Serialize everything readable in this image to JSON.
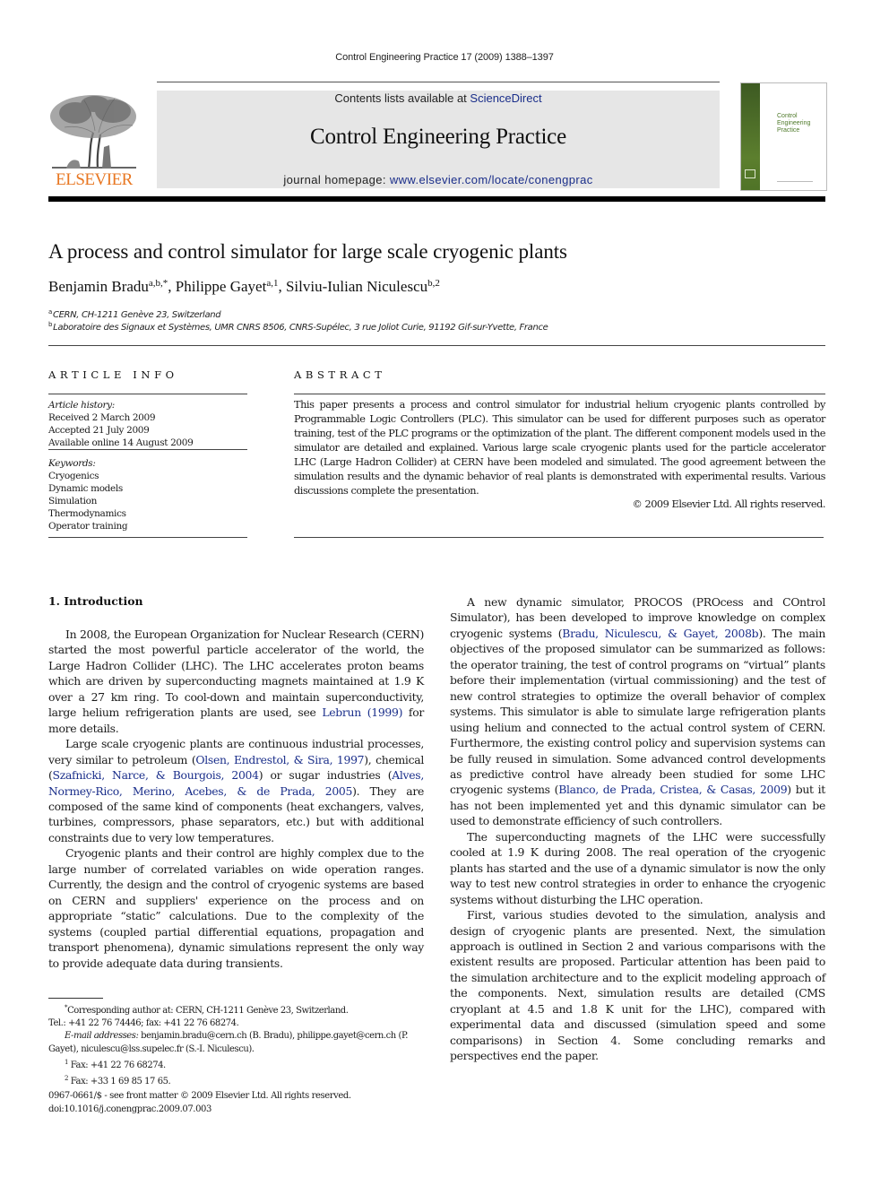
{
  "running_head": "Control Engineering Practice 17 (2009) 1388–1397",
  "masthead": {
    "publisher_logo_text": "ELSEVIER",
    "contents_prefix": "Contents lists available at ",
    "contents_link": "ScienceDirect",
    "journal_title": "Control Engineering Practice",
    "homepage_prefix": "journal homepage: ",
    "homepage_link": "www.elsevier.com/locate/conengprac",
    "cover_title": "Control\nEngineering\nPractice",
    "colors": {
      "elsevier_orange": "#e87722",
      "link_blue": "#1a2e8a",
      "masthead_gray": "#e6e6e6",
      "cover_green": "#4f7327"
    }
  },
  "article": {
    "title": "A process and control simulator for large scale cryogenic plants",
    "authors": [
      {
        "name": "Benjamin Bradu",
        "marks": "a,b,*",
        "sep": ", "
      },
      {
        "name": "Philippe Gayet",
        "marks": "a,1",
        "sep": ", "
      },
      {
        "name": "Silviu-Iulian Niculescu",
        "marks": "b,2",
        "sep": ""
      }
    ],
    "affiliations": [
      {
        "mark": "a",
        "text": "CERN, CH-1211 Genève 23, Switzerland"
      },
      {
        "mark": "b",
        "text": "Laboratoire des Signaux et Systèmes, UMR CNRS 8506, CNRS-Supélec, 3 rue Joliot Curie, 91192 Gif-sur-Yvette, France"
      }
    ]
  },
  "article_info": {
    "heading": "ARTICLE INFO",
    "history_label": "Article history:",
    "history": [
      "Received 2 March 2009",
      "Accepted 21 July 2009",
      "Available online 14 August 2009"
    ],
    "keywords_label": "Keywords:",
    "keywords": [
      "Cryogenics",
      "Dynamic models",
      "Simulation",
      "Thermodynamics",
      "Operator training"
    ]
  },
  "abstract": {
    "heading": "ABSTRACT",
    "text": "This paper presents a process and control simulator for industrial helium cryogenic plants controlled by Programmable Logic Controllers (PLC). This simulator can be used for different purposes such as operator training, test of the PLC programs or the optimization of the plant. The different component models used in the simulator are detailed and explained. Various large scale cryogenic plants used for the particle accelerator LHC (Large Hadron Collider) at CERN have been modeled and simulated. The good agreement between the simulation results and the dynamic behavior of real plants is demonstrated with experimental results. Various discussions complete the presentation.",
    "copyright": "© 2009 Elsevier Ltd. All rights reserved."
  },
  "body": {
    "section_heading": "1.  Introduction",
    "left_paragraphs": [
      [
        {
          "t": "In 2008, the European Organization for Nuclear Research (CERN) started the most powerful particle accelerator of the world, the Large Hadron Collider (LHC). The LHC accelerates proton beams which are driven by superconducting magnets maintained at 1.9 K over a 27 km ring. To cool-down and maintain superconductivity, large helium refrigeration plants are used, see "
        },
        {
          "t": "Lebrun (1999)",
          "link": true
        },
        {
          "t": " for more details."
        }
      ],
      [
        {
          "t": "Large scale cryogenic plants are continuous industrial processes, very similar to petroleum ("
        },
        {
          "t": "Olsen, Endrestol, & Sira, 1997",
          "link": true
        },
        {
          "t": "), chemical ("
        },
        {
          "t": "Szafnicki, Narce, & Bourgois, 2004",
          "link": true
        },
        {
          "t": ") or sugar industries ("
        },
        {
          "t": "Alves, Normey-Rico, Merino, Acebes, & de Prada, 2005",
          "link": true
        },
        {
          "t": "). They are composed of the same kind of components (heat exchangers, valves, turbines, compressors, phase separators, etc.) but with additional constraints due to very low temperatures."
        }
      ],
      [
        {
          "t": "Cryogenic plants and their control are highly complex due to the large number of correlated variables on wide operation ranges. Currently, the design and the control of cryogenic systems are based on CERN and suppliers' experience on the process and on appropriate “static” calculations. Due to the complexity of the systems (coupled partial differential equations, propagation and transport phenomena), dynamic simulations represent the only way to provide adequate data during transients."
        }
      ]
    ],
    "right_paragraphs": [
      [
        {
          "t": "A new dynamic simulator, PROCOS (PROcess and COntrol Simulator), has been developed to improve knowledge on complex cryogenic systems ("
        },
        {
          "t": "Bradu, Niculescu, & Gayet, 2008b",
          "link": true
        },
        {
          "t": "). The main objectives of the proposed simulator can be summarized as follows: the operator training, the test of control programs on “virtual” plants before their implementation (virtual commissioning) and the test of new control strategies to optimize the overall behavior of complex systems. This simulator is able to simulate large refrigeration plants using helium and connected to the actual control system of CERN. Furthermore, the existing control policy and supervision systems can be fully reused in simulation. Some advanced control developments as predictive control have already been studied for some LHC cryogenic systems ("
        },
        {
          "t": "Blanco, de Prada, Cristea, & Casas, 2009",
          "link": true
        },
        {
          "t": ") but it has not been implemented yet and this dynamic simulator can be used to demonstrate efficiency of such controllers."
        }
      ],
      [
        {
          "t": "The superconducting magnets of the LHC were successfully cooled at 1.9 K during 2008. The real operation of the cryogenic plants has started and the use of a dynamic simulator is now the only way to test new control strategies in order to enhance the cryogenic systems without disturbing the LHC operation."
        }
      ],
      [
        {
          "t": "First, various studies devoted to the simulation, analysis and design of cryogenic plants are presented. Next, the simulation approach is outlined in Section 2 and various comparisons with the existent results are proposed. Particular attention has been paid to the simulation architecture and to the explicit modeling approach of the components. Next, simulation results are detailed (CMS cryoplant at 4.5 and 1.8 K unit for the LHC), compared with experimental data and discussed (simulation speed and some comparisons) in Section 4. Some concluding remarks and perspectives end the paper."
        }
      ]
    ]
  },
  "footnotes": {
    "corresponding": "Corresponding author at: CERN, CH-1211 Genève 23, Switzerland.",
    "corresponding_mark": "*",
    "tel": "Tel.: +41 22 76 74446; fax: +41 22 76 68274.",
    "email_label": "E-mail addresses:",
    "emails": "benjamin.bradu@cern.ch (B. Bradu), philippe.gayet@cern.ch (P. Gayet), niculescu@lss.supelec.fr (S.-I. Niculescu).",
    "fn1_mark": "1",
    "fn1": "Fax: +41 22 76 68274.",
    "fn2_mark": "2",
    "fn2": "Fax: +33 1 69 85 17 65."
  },
  "issn_line": "0967-0661/$ - see front matter © 2009 Elsevier Ltd. All rights reserved.",
  "doi_line": "doi:10.1016/j.conengprac.2009.07.003"
}
